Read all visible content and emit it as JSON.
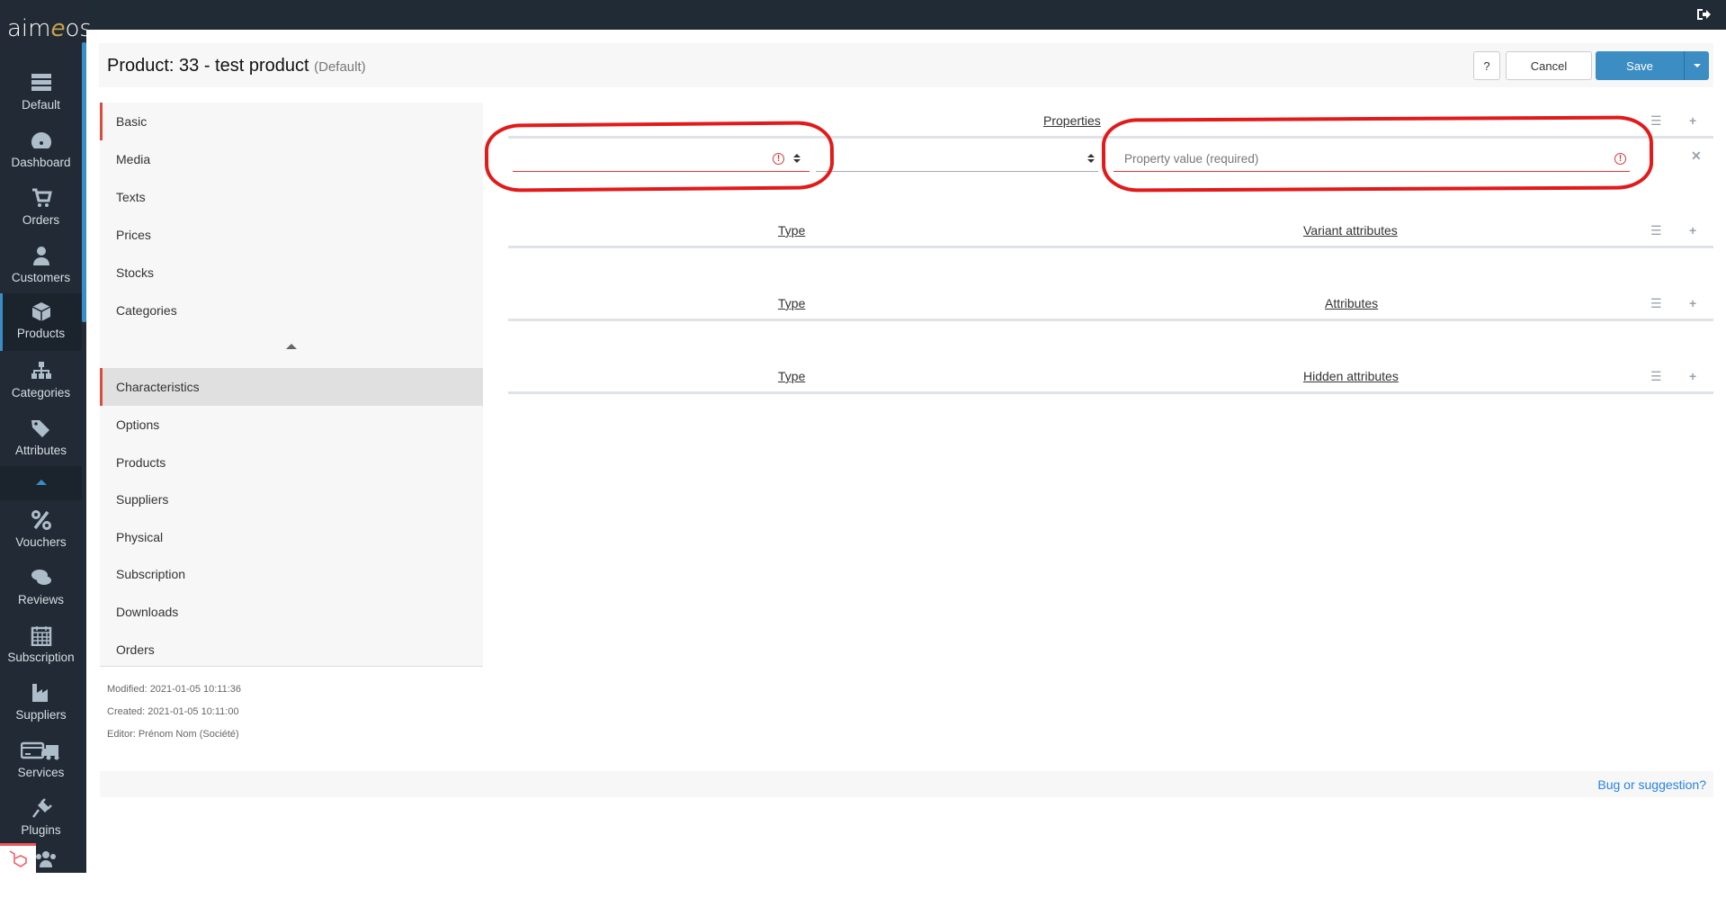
{
  "app": {
    "logo_prefix": "aim",
    "logo_e": "e",
    "logo_suffix": "os"
  },
  "topbar": {
    "logout_icon": "sign-out-icon"
  },
  "sidebar": {
    "items": [
      {
        "label": "Default",
        "icon": "server-icon"
      },
      {
        "label": "Dashboard",
        "icon": "tachometer-icon"
      },
      {
        "label": "Orders",
        "icon": "cart-icon"
      },
      {
        "label": "Customers",
        "icon": "user-icon"
      },
      {
        "label": "Products",
        "icon": "cube-icon",
        "active": true
      },
      {
        "label": "Categories",
        "icon": "sitemap-icon"
      },
      {
        "label": "Attributes",
        "icon": "tags-icon"
      },
      {
        "label": "Vouchers",
        "icon": "percent-icon"
      },
      {
        "label": "Reviews",
        "icon": "comments-icon"
      },
      {
        "label": "Subscription",
        "icon": "calendar-icon"
      },
      {
        "label": "Suppliers",
        "icon": "industry-icon"
      },
      {
        "label": "Services",
        "icon": "credit-card-truck-icon"
      },
      {
        "label": "Plugins",
        "icon": "plug-icon"
      },
      {
        "label": "",
        "icon": "users-icon"
      }
    ]
  },
  "header": {
    "title": "Product: 33 - test product",
    "site": "(Default)",
    "help_label": "?",
    "cancel_label": "Cancel",
    "save_label": "Save"
  },
  "nav": {
    "basic_items": [
      "Basic",
      "Media",
      "Texts",
      "Prices",
      "Stocks",
      "Categories"
    ],
    "advanced_items": [
      "Characteristics",
      "Options",
      "Products",
      "Suppliers",
      "Physical",
      "Subscription",
      "Downloads",
      "Orders"
    ],
    "active_basic": "Basic",
    "active_advanced": "Characteristics"
  },
  "meta": {
    "modified": "Modified: 2021-01-05 10:11:36",
    "created": "Created: 2021-01-05 10:11:00",
    "editor": "Editor: Prénom Nom (Société)"
  },
  "properties": {
    "header": "Properties",
    "row": {
      "type_value": "",
      "language_value": "",
      "value_placeholder": "Property value (required)"
    }
  },
  "sections": [
    {
      "type_label": "Type",
      "header": "Variant attributes"
    },
    {
      "type_label": "Type",
      "header": "Attributes"
    },
    {
      "type_label": "Type",
      "header": "Hidden attributes"
    }
  ],
  "footer": {
    "bug_link": "Bug or suggestion?"
  },
  "colors": {
    "accent": "#3c8dc3",
    "error": "#d9383a",
    "active_marker": "#dc4c3e",
    "annotation": "#e21a1a"
  }
}
